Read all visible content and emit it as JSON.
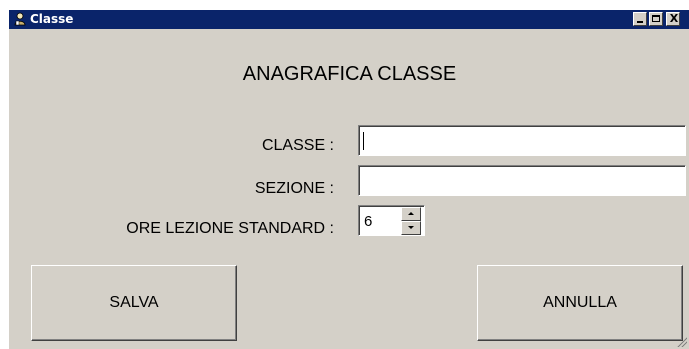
{
  "window": {
    "title": "Classe",
    "icon": "app-person-icon",
    "controls": {
      "minimize": "minimize-icon",
      "maximize": "maximize-icon",
      "close": "X"
    },
    "colors": {
      "titlebar": "#0a246a",
      "face": "#d4d0c8"
    }
  },
  "form": {
    "heading": "ANAGRAFICA CLASSE",
    "fields": {
      "classe": {
        "label": "CLASSE :",
        "value": ""
      },
      "sezione": {
        "label": "SEZIONE :",
        "value": ""
      },
      "ore_lezione": {
        "label": "ORE LEZIONE STANDARD :",
        "value": "6"
      }
    }
  },
  "buttons": {
    "save": "SALVA",
    "cancel": "ANNULLA"
  }
}
